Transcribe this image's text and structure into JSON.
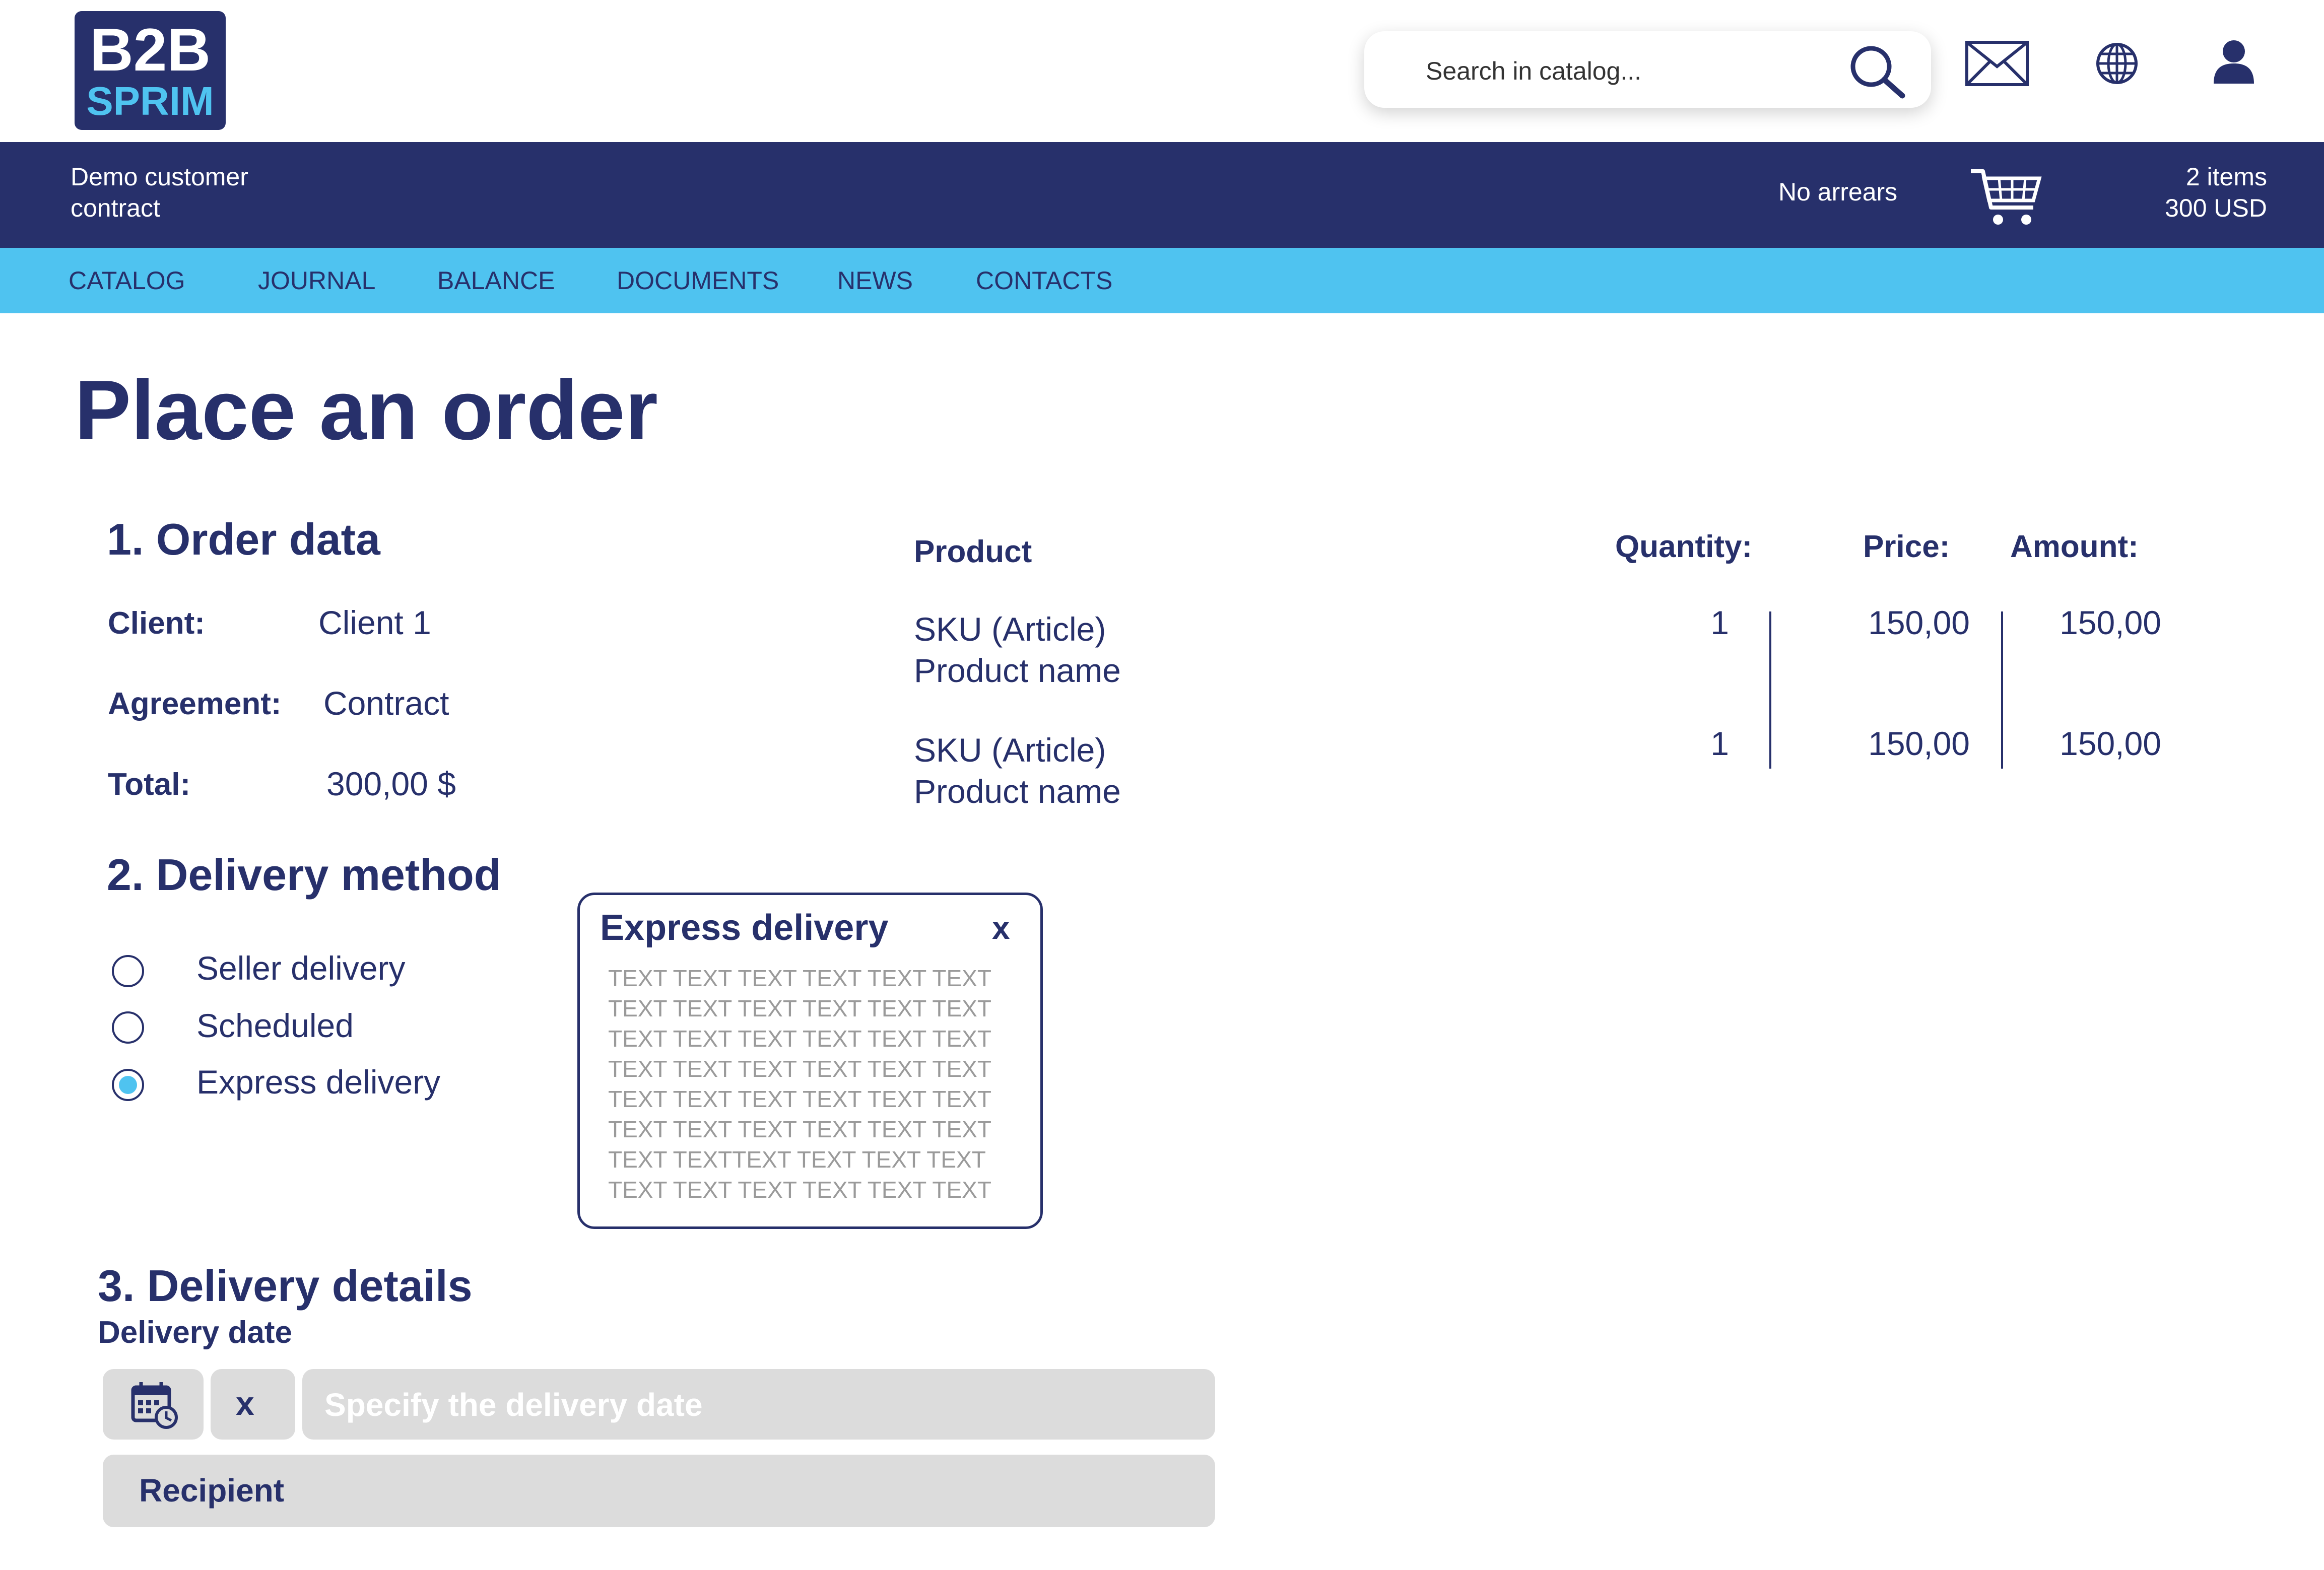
{
  "brand": {
    "logo_top": "B2B",
    "logo_bottom": "SPRIM"
  },
  "search": {
    "placeholder": "Search in catalog..."
  },
  "top_icons": [
    "mail-icon",
    "globe-icon",
    "user-icon"
  ],
  "account": {
    "customer": "Demo customer contract",
    "arrears": "No arrears",
    "cart_items": "2 items",
    "cart_total": "300 USD"
  },
  "nav": [
    "CATALOG",
    "JOURNAL",
    "BALANCE",
    "DOCUMENTS",
    "NEWS",
    "CONTACTS"
  ],
  "page_title": "Place an order",
  "order_data": {
    "heading": "1. Order data",
    "client_label": "Client:",
    "client_value": "Client 1",
    "agreement_label": "Agreement:",
    "agreement_value": "Contract",
    "total_label": "Total:",
    "total_value": "300,00 $"
  },
  "products": {
    "headers": {
      "product": "Product",
      "quantity": "Quantity:",
      "price": "Price:",
      "amount": "Amount:"
    },
    "rows": [
      {
        "sku": "SKU (Article)",
        "name": "Product name",
        "quantity": "1",
        "price": "150,00",
        "amount": "150,00"
      },
      {
        "sku": "SKU (Article)",
        "name": "Product name",
        "quantity": "1",
        "price": "150,00",
        "amount": "150,00"
      }
    ]
  },
  "delivery_method": {
    "heading": "2. Delivery method",
    "options": [
      {
        "label": "Seller delivery",
        "selected": false
      },
      {
        "label": "Scheduled",
        "selected": false
      },
      {
        "label": "Express delivery",
        "selected": true
      }
    ]
  },
  "popup": {
    "title": "Express delivery",
    "close": "x",
    "lines": [
      "TEXT TEXT TEXT TEXT TEXT TEXT",
      "TEXT TEXT TEXT TEXT TEXT TEXT",
      "TEXT TEXT TEXT TEXT TEXT TEXT",
      "TEXT TEXT TEXT TEXT TEXT TEXT",
      "TEXT TEXT TEXT TEXT TEXT TEXT",
      "TEXT TEXT TEXT TEXT TEXT TEXT",
      "TEXT TEXTTEXT TEXT TEXT TEXT",
      "TEXT TEXT TEXT TEXT TEXT TEXT"
    ]
  },
  "delivery_details": {
    "heading": "3. Delivery details",
    "date_label": "Delivery date",
    "clear": "x",
    "date_placeholder": "Specify the delivery date",
    "recipient": "Recipient"
  },
  "colors": {
    "navy": "#27306b",
    "sky": "#4fc3f0",
    "field": "#dcdcdc"
  }
}
